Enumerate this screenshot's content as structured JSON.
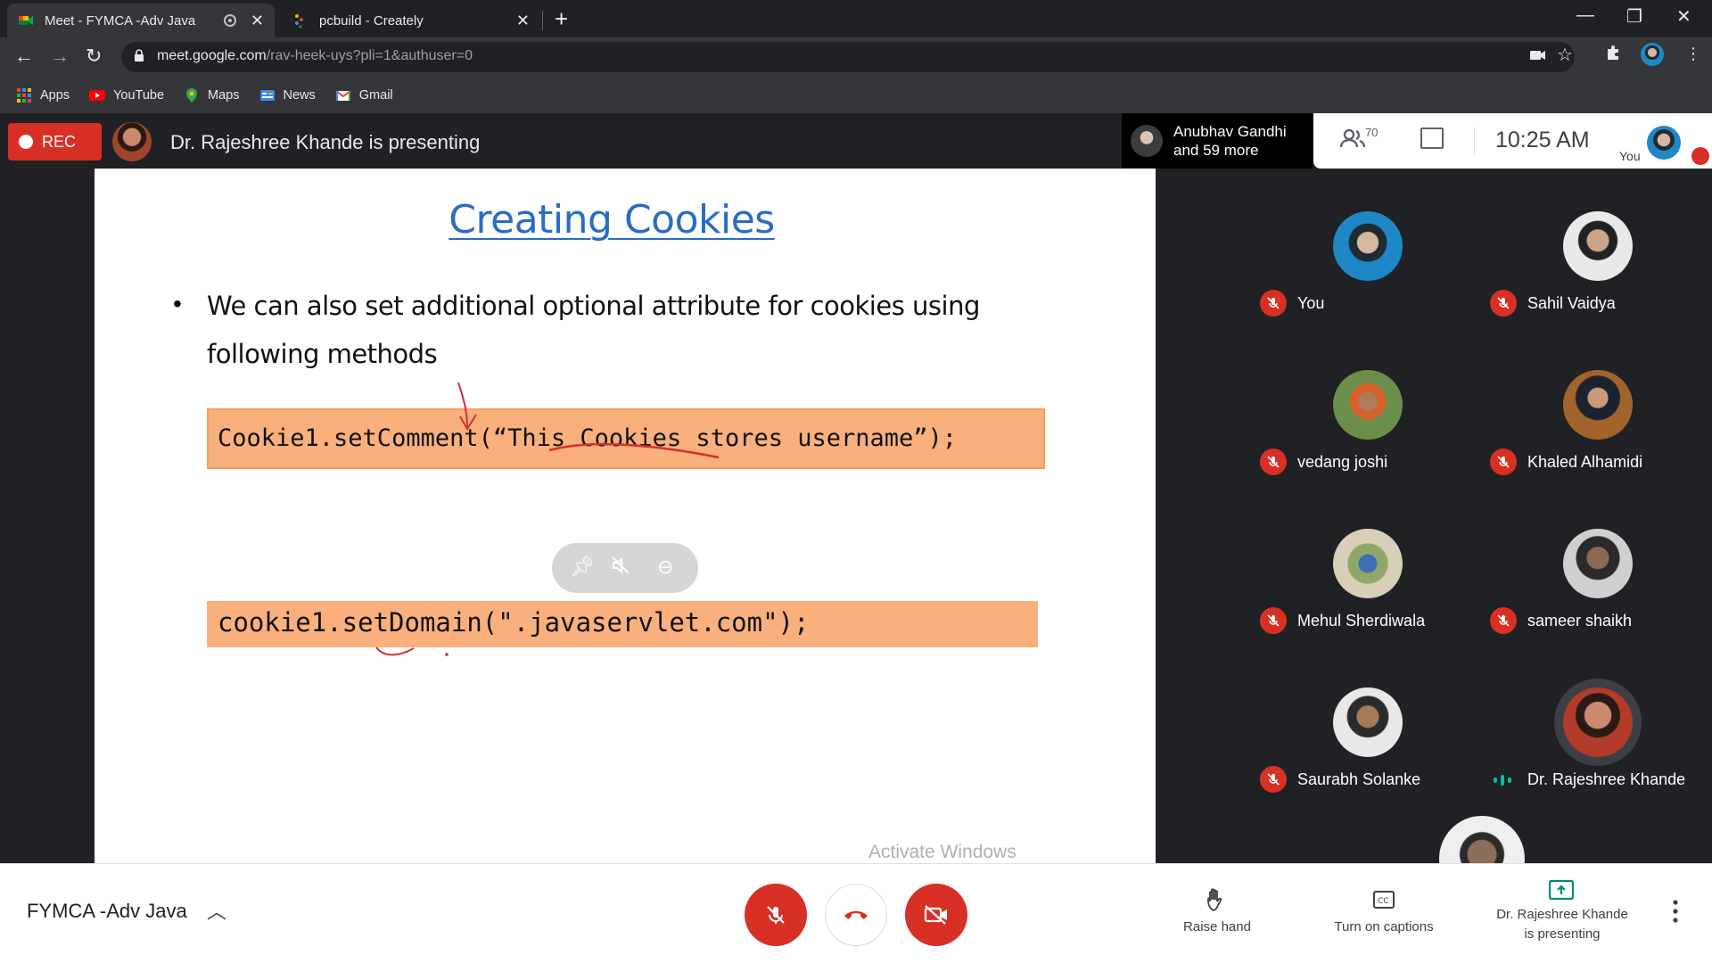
{
  "browser": {
    "tabs": [
      {
        "title": "Meet - FYMCA -Adv Java",
        "active": true
      },
      {
        "title": "pcbuild - Creately",
        "active": false
      }
    ],
    "url_domain": "meet.google.com",
    "url_path": "/rav-heek-uys?pli=1&authuser=0",
    "bookmarks": [
      "Apps",
      "YouTube",
      "Maps",
      "News",
      "Gmail"
    ]
  },
  "meet": {
    "rec_label": "REC",
    "presenting_text": "Dr. Rajeshree Khande is presenting",
    "participants_chip_line1": "Anubhav Gandhi",
    "participants_chip_line2": "and 59 more",
    "participant_count": "70",
    "time": "10:25 AM",
    "self_label": "You"
  },
  "slide": {
    "title": "Creating Cookies",
    "bullet": "We can also  set additional optional attribute for cookies using following methods",
    "code1": "Cookie1.setComment(“This Cookies stores username”);",
    "code2": "cookie1.setDomain(\".javaservlet.com\");",
    "watermark": "Activate Windows"
  },
  "tiles": [
    {
      "name": "You",
      "muted": true
    },
    {
      "name": "Sahil Vaidya",
      "muted": true
    },
    {
      "name": "vedang joshi",
      "muted": true
    },
    {
      "name": "Khaled Alhamidi",
      "muted": true
    },
    {
      "name": "Mehul Sherdiwala",
      "muted": true
    },
    {
      "name": "sameer shaikh",
      "muted": true
    },
    {
      "name": "Saurabh Solanke",
      "muted": true
    },
    {
      "name": "Dr. Rajeshree Khande",
      "muted": false,
      "speaking": true
    }
  ],
  "controls": {
    "meeting_name": "FYMCA -Adv Java",
    "raise_hand": "Raise hand",
    "captions": "Turn on captions",
    "presenting_line1": "Dr. Rajeshree Khande",
    "presenting_line2": "is presenting"
  },
  "colors": {
    "accent_red": "#d93025",
    "slide_title_blue": "#2a6cc2",
    "code_bg": "#f9b07d",
    "present_green": "#00897b"
  }
}
